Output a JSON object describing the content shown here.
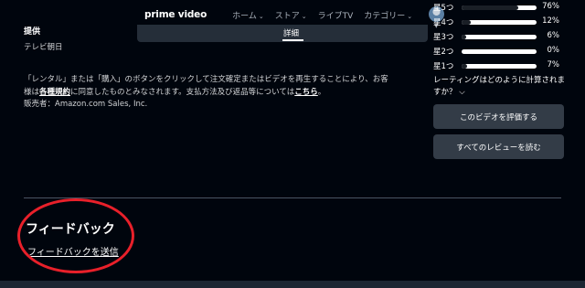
{
  "details": {
    "provider_heading": "提供",
    "provider_name": "テレビ朝日",
    "legal_part1": "「レンタル」または「購入」のボタンをクリックして注文確定またはビデオを再生することにより、お客様は",
    "legal_link1": "各種規約",
    "legal_part2": "に同意したものとみなされます。支払方法及び返品等については",
    "legal_link2": "こちら",
    "legal_part3": "。",
    "seller": "販売者：Amazon.com Sales, Inc."
  },
  "feedback": {
    "heading": "フィードバック",
    "link": "フィードバックを送信"
  },
  "nav": {
    "logo": "prime video",
    "items": [
      "ホーム",
      "ストア",
      "ライブTV",
      "カテゴリー"
    ],
    "active_tab": "詳細"
  },
  "ratings": {
    "rows": [
      {
        "label": "星5つ",
        "percent": 76,
        "text": "76%"
      },
      {
        "label": "星4つ",
        "percent": 12,
        "text": "12%"
      },
      {
        "label": "星3つ",
        "percent": 6,
        "text": "6%"
      },
      {
        "label": "星2つ",
        "percent": 0,
        "text": "0%"
      },
      {
        "label": "星1つ",
        "percent": 7,
        "text": "7%"
      }
    ],
    "question": "レーティングはどのように計算されますか？",
    "rate_button": "このビデオを評価する",
    "reviews_button": "すべてのレビューを読む"
  },
  "colors": {
    "background": "#00050d",
    "annotation": "#e8202a",
    "button": "#333c47"
  }
}
